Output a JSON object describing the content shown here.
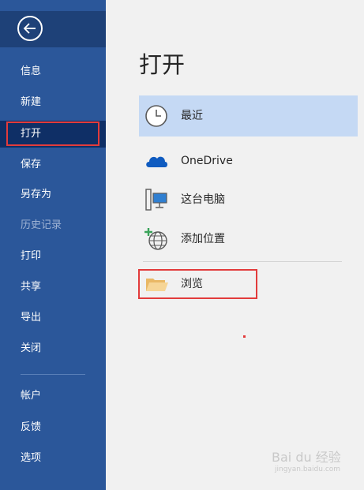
{
  "sidebar": {
    "back_icon": "arrow-left-circle-icon",
    "items": [
      {
        "label": "信息",
        "state": "normal"
      },
      {
        "label": "新建",
        "state": "normal"
      },
      {
        "label": "打开",
        "state": "selected"
      },
      {
        "label": "保存",
        "state": "normal"
      },
      {
        "label": "另存为",
        "state": "normal"
      },
      {
        "label": "历史记录",
        "state": "disabled"
      },
      {
        "label": "打印",
        "state": "normal"
      },
      {
        "label": "共享",
        "state": "normal"
      },
      {
        "label": "导出",
        "state": "normal"
      },
      {
        "label": "关闭",
        "state": "normal"
      },
      {
        "label": "帐户",
        "state": "normal"
      },
      {
        "label": "反馈",
        "state": "normal"
      },
      {
        "label": "选项",
        "state": "normal"
      }
    ]
  },
  "main": {
    "title": "打开",
    "locations": [
      {
        "label": "最近",
        "icon": "clock-icon",
        "selected": true
      },
      {
        "label": "OneDrive",
        "icon": "cloud-icon",
        "selected": false
      },
      {
        "label": "这台电脑",
        "icon": "computer-icon",
        "selected": false
      },
      {
        "label": "添加位置",
        "icon": "globe-add-icon",
        "selected": false
      },
      {
        "label": "浏览",
        "icon": "folder-icon",
        "selected": false
      }
    ]
  },
  "watermark": {
    "text": "Bai du 经验",
    "sub": "jingyan.baidu.com"
  },
  "colors": {
    "sidebar_bg": "#2b579a",
    "sidebar_selected": "#0f2f66",
    "content_bg": "#f1f1f1",
    "selected_row": "#c5d9f4",
    "highlight_border": "#e23b3b"
  }
}
